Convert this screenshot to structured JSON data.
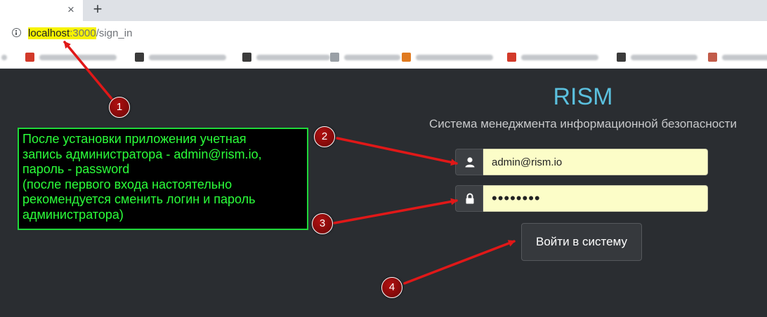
{
  "browser": {
    "tab_close_glyph": "×",
    "new_tab_glyph": "+",
    "url": {
      "host": "localhost",
      "port": ":3000",
      "path": "/sign_in"
    },
    "bookmarks": [
      {
        "icon": "favicon-red",
        "color": "#d23a2a"
      },
      {
        "icon": "favicon-github",
        "color": "#3b3b3b"
      },
      {
        "icon": "favicon-github",
        "color": "#3b3b3b"
      },
      {
        "icon": "favicon-generic",
        "color": "#9aa0a6"
      },
      {
        "icon": "favicon-orange",
        "color": "#e07a20"
      },
      {
        "icon": "favicon-red",
        "color": "#d23a2a"
      },
      {
        "icon": "favicon-github",
        "color": "#3b3b3b"
      },
      {
        "icon": "favicon-generic",
        "color": "#c25c4a"
      }
    ]
  },
  "app": {
    "brand": "RISM",
    "subtitle": "Система менеджмента информационной безопасности"
  },
  "form": {
    "email_value": "admin@rism.io",
    "password_value": "••••••••",
    "submit_label": "Войти в систему"
  },
  "annotation": {
    "note": "После установки приложения учетная\nзапись администратора - admin@rism.io,\nпароль - password\n(после первого входа настоятельно\nрекомендуется сменить логин и пароль\nадминистратора)",
    "markers": [
      "1",
      "2",
      "3",
      "4"
    ]
  },
  "colors": {
    "brand": "#5bc0de",
    "page_bg": "#2a2d31",
    "input_bg": "#fcfdc8",
    "note_text": "#2bff3a",
    "arrow": "#e01818"
  }
}
